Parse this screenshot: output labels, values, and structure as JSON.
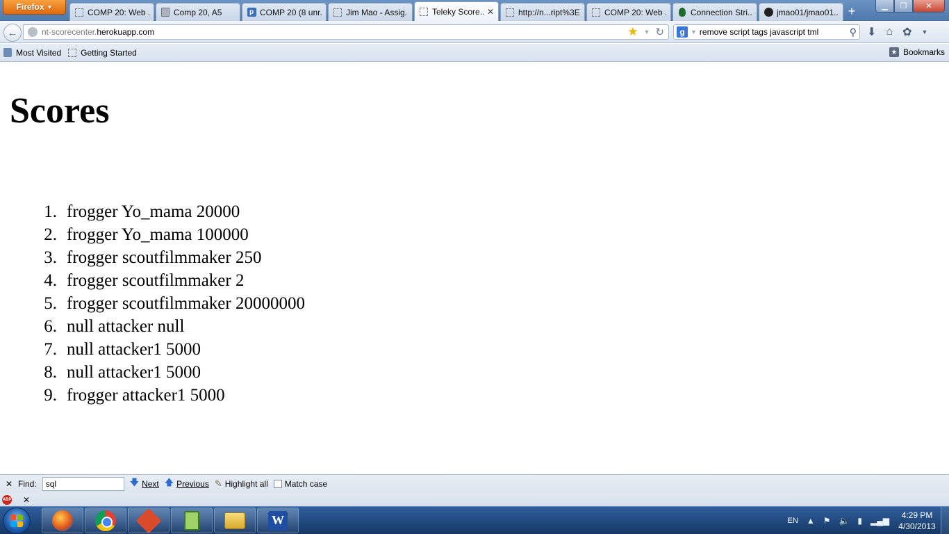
{
  "browser": {
    "app_button": "Firefox",
    "tabs": [
      {
        "label": "COMP 20: Web ...",
        "icon": "blank-page-icon"
      },
      {
        "label": "Comp 20, A5",
        "icon": "document-icon"
      },
      {
        "label": "COMP 20 (8 unr...",
        "icon": "p-icon"
      },
      {
        "label": "Jim Mao - Assig...",
        "icon": "blank-page-icon"
      },
      {
        "label": "Teleky Score...",
        "icon": "blank-page-icon",
        "active": true
      },
      {
        "label": "http://n...ript%3E",
        "icon": "blank-page-icon"
      },
      {
        "label": "COMP 20: Web ...",
        "icon": "blank-page-icon"
      },
      {
        "label": "Connection Stri...",
        "icon": "leaf-icon"
      },
      {
        "label": "jmao01/jmao01....",
        "icon": "github-icon"
      }
    ],
    "url_prefix": "nt-scorecenter.",
    "url_host": "herokuapp.com",
    "search_query": "remove script tags javascript tml",
    "search_engine_letter": "g",
    "bookmarks": [
      {
        "label": "Most Visited"
      },
      {
        "label": "Getting Started"
      }
    ],
    "bookmarks_menu": "Bookmarks"
  },
  "page": {
    "title": "Scores",
    "scores": [
      {
        "num": "1.",
        "text": "frogger Yo_mama 20000"
      },
      {
        "num": "2.",
        "text": "frogger Yo_mama 100000"
      },
      {
        "num": "3.",
        "text": "frogger scoutfilmmaker 250"
      },
      {
        "num": "4.",
        "text": "frogger scoutfilmmaker 2"
      },
      {
        "num": "5.",
        "text": "frogger scoutfilmmaker 20000000"
      },
      {
        "num": "6.",
        "text": "null attacker null"
      },
      {
        "num": "7.",
        "text": "null attacker1 5000"
      },
      {
        "num": "8.",
        "text": "null attacker1 5000"
      },
      {
        "num": "9.",
        "text": "frogger attacker1 5000"
      }
    ]
  },
  "findbar": {
    "label": "Find:",
    "value": "sql",
    "next": "Next",
    "previous": "Previous",
    "highlight": "Highlight all",
    "match_case": "Match case"
  },
  "addon": {
    "abp_label": "ABP"
  },
  "taskbar": {
    "apps": [
      "firefox-icon",
      "chrome-icon",
      "git-icon",
      "notepad-plus-icon",
      "folder-icon",
      "word-icon"
    ],
    "word_letter": "W",
    "lang": "EN",
    "time": "4:29 PM",
    "date": "4/30/2013"
  }
}
